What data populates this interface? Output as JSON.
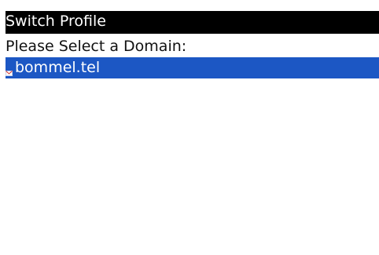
{
  "header": {
    "title": "Switch Profile"
  },
  "prompt": {
    "text": "Please Select a Domain:"
  },
  "domains": [
    {
      "label": "bommel.tel",
      "icon": "envelope-icon",
      "selected": true
    }
  ],
  "colors": {
    "header_bg": "#000000",
    "selection_bg": "#1c57c4"
  }
}
